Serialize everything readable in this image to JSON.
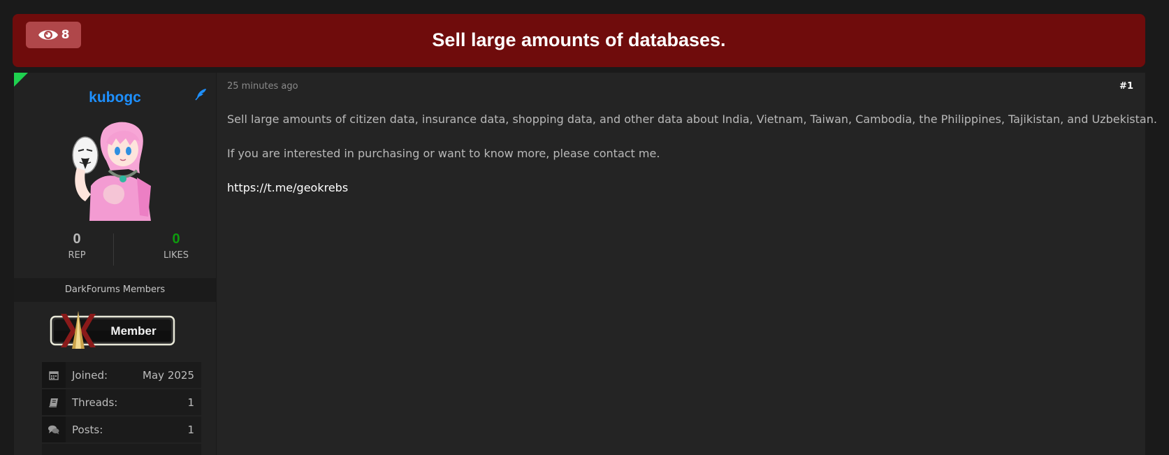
{
  "thread": {
    "views": "8",
    "title": "Sell large amounts of databases."
  },
  "author": {
    "username": "kubogc",
    "rep_value": "0",
    "rep_label": "REP",
    "likes_value": "0",
    "likes_label": "LIKES",
    "group": "DarkForums Members",
    "rank_badge_text": "Member",
    "info": [
      {
        "icon": "calendar-icon",
        "label": "Joined:",
        "value": "May 2025"
      },
      {
        "icon": "book-icon",
        "label": "Threads:",
        "value": "1"
      },
      {
        "icon": "comments-icon",
        "label": "Posts:",
        "value": "1"
      }
    ],
    "colors": {
      "username": "#1e90ff",
      "likes": "#0e9b0e",
      "online": "#1fd14f"
    }
  },
  "post": {
    "date": "25 minutes ago",
    "number": "#1",
    "paragraphs": [
      "Sell large amounts of citizen data, insurance data, shopping data, and other data about India, Vietnam, Taiwan, Cambodia, the Philippines, Tajikistan, and Uzbekistan.",
      "If you are interested in purchasing or want to know more, please contact me."
    ],
    "link": "https://t.me/geokrebs"
  },
  "colors": {
    "header_bg": "#6f0c0c",
    "badge_bg": "#b0474a",
    "page_bg": "#1a1a1a"
  }
}
